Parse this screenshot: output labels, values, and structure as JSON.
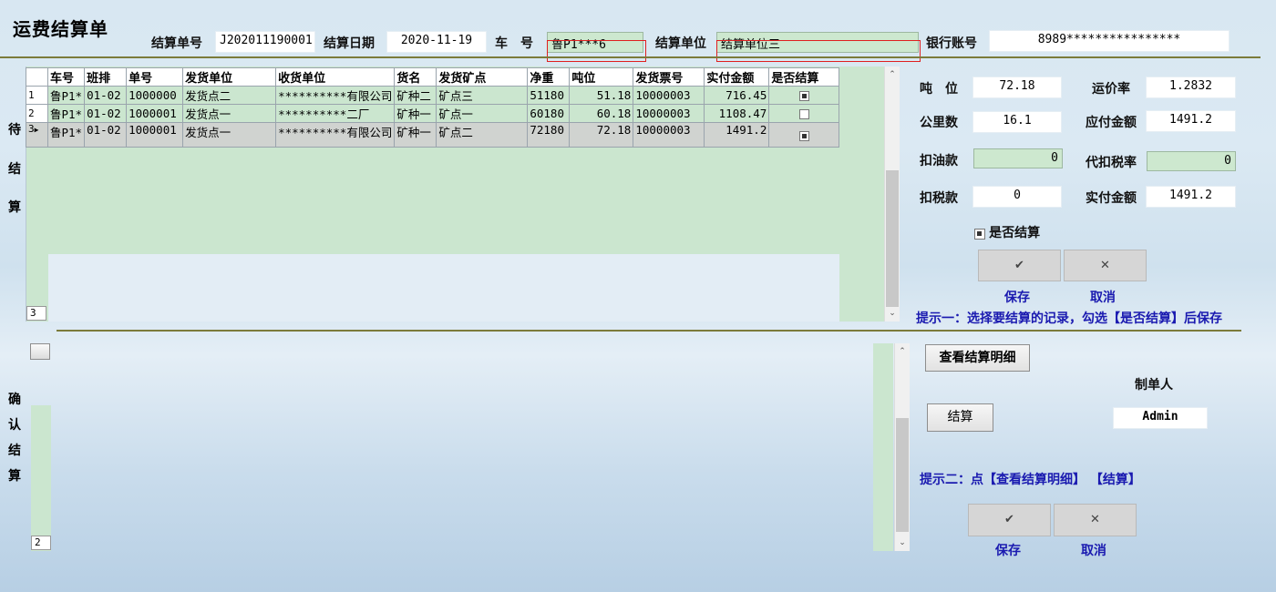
{
  "header": {
    "title": "运费结算单",
    "settle_no_label": "结算单号",
    "settle_no": "J202011190001",
    "settle_date_label": "结算日期",
    "settle_date": "2020-11-19",
    "plate_label": "车　号",
    "plate": "鲁P1***6",
    "unit_label": "结算单位",
    "unit": "结算单位三",
    "bank_label": "银行账号",
    "bank": "8989****************"
  },
  "pending": {
    "side_label": [
      "待",
      "结",
      "算"
    ],
    "columns": [
      "车号",
      "班排",
      "单号",
      "发货单位",
      "收货单位",
      "货名",
      "发货矿点",
      "净重",
      "吨位",
      "发货票号",
      "实付金额",
      "是否结算"
    ],
    "rows": [
      {
        "idx": "1",
        "plate": "鲁P1*",
        "shift": "01-02",
        "no": "1000000",
        "sender": "发货点二",
        "receiver": "**********有限公司",
        "goods": "矿种二",
        "mine": "矿点三",
        "net": "51180",
        "ton": "51.18",
        "ticket": "10000003",
        "pay": "716.45",
        "settled": true
      },
      {
        "idx": "2",
        "plate": "鲁P1*",
        "shift": "01-02",
        "no": "1000001",
        "sender": "发货点一",
        "receiver": "**********二厂",
        "goods": "矿种一",
        "mine": "矿点一",
        "net": "60180",
        "ton": "60.18",
        "ticket": "10000003",
        "pay": "1108.47",
        "settled": false
      },
      {
        "idx": "3",
        "plate": "鲁P1*",
        "shift": "01-02",
        "no": "1000001",
        "sender": "发货点一",
        "receiver": "**********有限公司",
        "goods": "矿种一",
        "mine": "矿点二",
        "net": "72180",
        "ton": "72.18",
        "ticket": "10000003",
        "pay": "1491.2",
        "settled": true
      }
    ],
    "row_count": "3"
  },
  "detail": {
    "ton_label": "吨　位",
    "ton": "72.18",
    "rate_label": "运价率",
    "rate": "1.2832",
    "km_label": "公里数",
    "km": "16.1",
    "payable_label": "应付金额",
    "payable": "1491.2",
    "oil_label": "扣油款",
    "oil": "0",
    "taxrate_label": "代扣税率",
    "taxrate": "0",
    "tax_label": "扣税款",
    "tax": "0",
    "actual_label": "实付金额",
    "actual": "1491.2",
    "settle_check_label": "是否结算",
    "save_label": "保存",
    "cancel_label": "取消",
    "hint1": "提示一：选择要结算的记录，勾选【是否结算】后保存"
  },
  "confirm": {
    "side_label": [
      "确",
      "认",
      "结",
      "算"
    ],
    "row_count": "2",
    "view_detail_label": "查看结算明细",
    "maker_label": "制单人",
    "maker": "Admin",
    "settle_label": "结算",
    "hint2": "提示二：点【查看结算明细】 【结算】",
    "save_label": "保存",
    "cancel_label": "取消"
  }
}
